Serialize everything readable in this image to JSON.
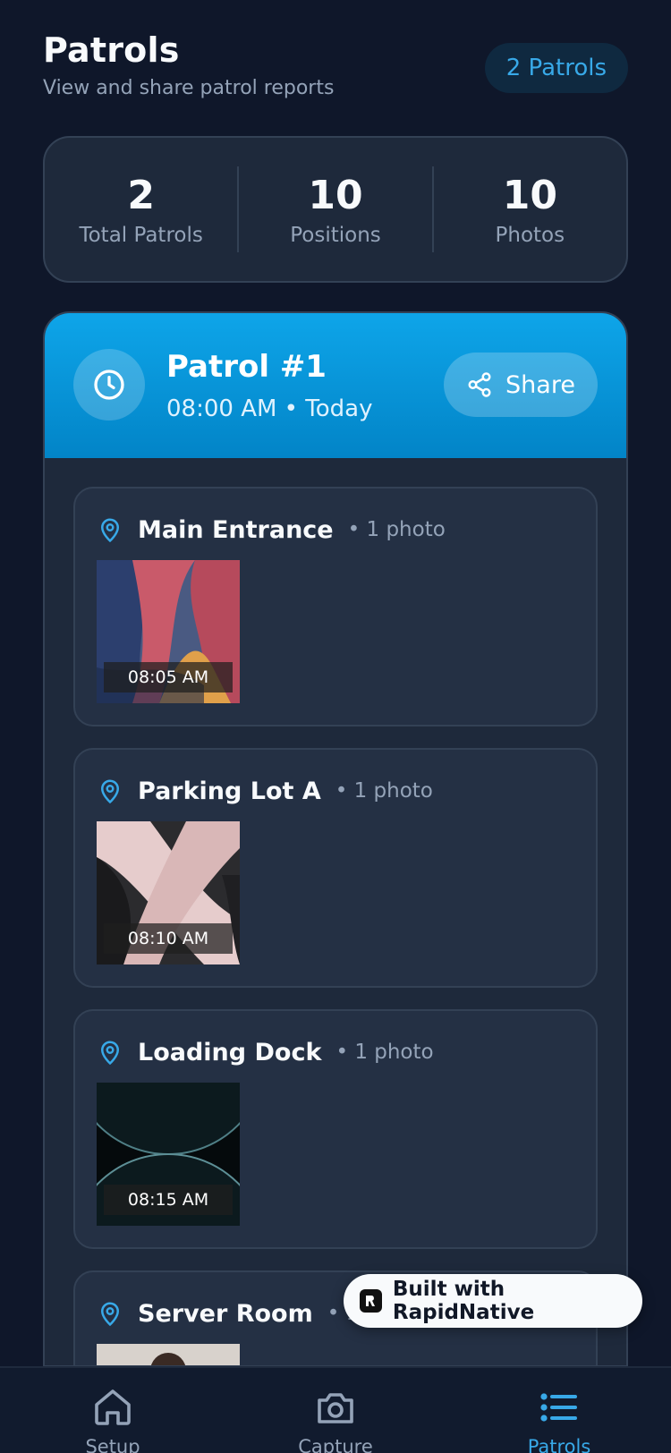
{
  "header": {
    "title": "Patrols",
    "subtitle": "View and share patrol reports",
    "count_pill": "2 Patrols"
  },
  "stats": [
    {
      "value": "2",
      "label": "Total Patrols"
    },
    {
      "value": "10",
      "label": "Positions"
    },
    {
      "value": "10",
      "label": "Photos"
    }
  ],
  "patrol": {
    "title": "Patrol #1",
    "subtitle": "08:00 AM • Today",
    "share_label": "Share",
    "positions": [
      {
        "name": "Main Entrance",
        "count": "• 1 photo",
        "time": "08:05 AM"
      },
      {
        "name": "Parking Lot A",
        "count": "• 1 photo",
        "time": "08:10 AM"
      },
      {
        "name": "Loading Dock",
        "count": "• 1 photo",
        "time": "08:15 AM"
      },
      {
        "name": "Server Room",
        "count": "• 1 photo",
        "time": ""
      }
    ]
  },
  "tabs": [
    {
      "label": "Setup",
      "icon": "home-icon",
      "active": false
    },
    {
      "label": "Capture",
      "icon": "camera-icon",
      "active": false
    },
    {
      "label": "Patrols",
      "icon": "list-icon",
      "active": true
    }
  ],
  "badge": {
    "label": "Built with RapidNative"
  },
  "colors": {
    "background": "#0f172a",
    "card": "#1e293b",
    "accent": "#0ea5e9",
    "accent_text": "#38a9e8",
    "muted": "#94a3b8"
  }
}
